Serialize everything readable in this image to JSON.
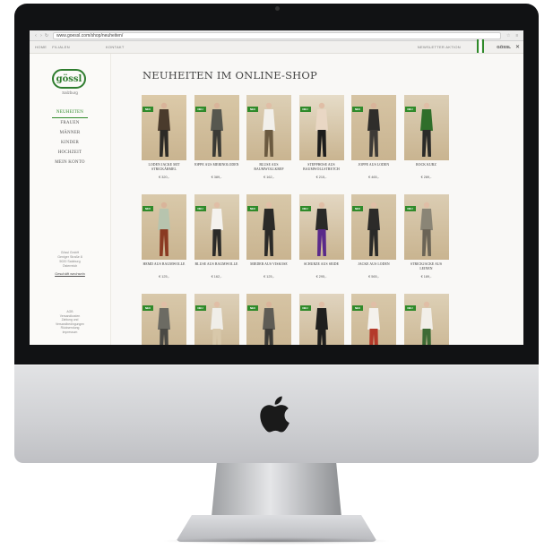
{
  "browser": {
    "url": "www.goessl.com/shop/neuheiten/",
    "nav_icons": [
      "back-arrow-icon",
      "forward-arrow-icon",
      "reload-icon"
    ]
  },
  "topbar": {
    "left_items": [
      "HOME",
      "FILIALEN",
      "KONTAKT"
    ],
    "right_text": "NEWSLETTER AKTION",
    "brand": "GÖSSL"
  },
  "sidebar": {
    "logo": "gössl",
    "logo_sub": "Salzburg",
    "nav": [
      {
        "label": "NEUHEITEN",
        "active": true
      },
      {
        "label": "FRAUEN",
        "active": false
      },
      {
        "label": "MÄNNER",
        "active": false
      },
      {
        "label": "KINDER",
        "active": false
      },
      {
        "label": "HOCHZEIT",
        "active": false
      },
      {
        "label": "MEIN KONTO",
        "active": false
      }
    ],
    "address": "Gössl GmbH\nGeniger Straße 8\n5020 Salzburg\nÖsterreich",
    "link": "Geschäft wechseln",
    "footer": "AGB\nVersandkosten\nZahlung und\nVersandbedingungen\nRücksendung\nImpressum"
  },
  "main": {
    "title": "NEUHEITEN IM ONLINE-SHOP",
    "badge": "NEU",
    "products": [
      {
        "name": "LODEN JACKE MIT STRICKÄRMEL",
        "price": "€ 320,-",
        "bg": "#dccaa9",
        "top": "#4a3b2c",
        "bottom": "#2c2a26",
        "skin": "#d9b49a"
      },
      {
        "name": "JOPPE AUS MERINOLODEN",
        "price": "€ 389,-",
        "bg": "#d8c7a6",
        "top": "#56574f",
        "bottom": "#3a3a35",
        "skin": "#d9b49a"
      },
      {
        "name": "BLUSE AUS BAUMWOLLKREP",
        "price": "€ 162,-",
        "bg": "#ddd0b6",
        "top": "#f2f0eb",
        "bottom": "#6b5a40",
        "skin": "#e0bea6"
      },
      {
        "name": "STEPPHOSE AUS BAUMWOLLSTRETCH",
        "price": "€ 215,-",
        "bg": "#e6dcc8",
        "top": "#e9d7c4",
        "bottom": "#1c1c1c",
        "skin": "#e0bea6"
      },
      {
        "name": "JOPPE AUS LODEN",
        "price": "€ 465,-",
        "bg": "#d6c4a4",
        "top": "#2f2e2b",
        "bottom": "#3d3a36",
        "skin": "#d9b49a"
      },
      {
        "name": "ROCK KURZ",
        "price": "€ 289,-",
        "bg": "#dccfb6",
        "top": "#2f6e2a",
        "bottom": "#2a2a28",
        "skin": "#e0bea6"
      },
      {
        "name": "HEMD AUS BAUMWOLLE",
        "price": "€ 125,-",
        "bg": "#d9c9aa",
        "top": "#b7c4ae",
        "bottom": "#8a3a22",
        "skin": "#d9b49a"
      },
      {
        "name": "BLUSE AUS BAUMWOLLE",
        "price": "€ 162,-",
        "bg": "#ddd0b6",
        "top": "#f4f2ee",
        "bottom": "#2a2a28",
        "skin": "#e0bea6"
      },
      {
        "name": "MIEDER AUS VISKOSE",
        "price": "€ 125,-",
        "bg": "#d8c8a9",
        "top": "#2a2a28",
        "bottom": "#2a2a28",
        "skin": "#e0bea6"
      },
      {
        "name": "SCHÜRZE AUS SEIDE",
        "price": "€ 295,-",
        "bg": "#e3d7c2",
        "top": "#2a2a28",
        "bottom": "#5a2a8a",
        "skin": "#e0bea6"
      },
      {
        "name": "JACKE AUS LODEN",
        "price": "€ 565,-",
        "bg": "#d6c6a8",
        "top": "#2c2b29",
        "bottom": "#2a2a28",
        "skin": "#e0bea6"
      },
      {
        "name": "STRICKJACKE AUS LEINEN",
        "price": "€ 189,-",
        "bg": "#dbcdb3",
        "top": "#8a8576",
        "bottom": "#6b6456",
        "skin": "#e0bea6"
      },
      {
        "name": "",
        "price": "",
        "bg": "#d8c8aa",
        "top": "#6c6b63",
        "bottom": "#4a4944",
        "skin": "#e0bea6"
      },
      {
        "name": "",
        "price": "",
        "bg": "#ddd0b8",
        "top": "#f0eee9",
        "bottom": "#d8c8aa",
        "skin": "#e0bea6"
      },
      {
        "name": "",
        "price": "",
        "bg": "#d6c4a4",
        "top": "#5e5c55",
        "bottom": "#3c3b37",
        "skin": "#d9b49a"
      },
      {
        "name": "",
        "price": "",
        "bg": "#e0d4bf",
        "top": "#1f1f1e",
        "bottom": "#1f1f1e",
        "skin": "#e0bea6"
      },
      {
        "name": "",
        "price": "",
        "bg": "#d8c8aa",
        "top": "#f4f1ec",
        "bottom": "#b43a2a",
        "skin": "#e0bea6"
      },
      {
        "name": "",
        "price": "",
        "bg": "#ddd0b6",
        "top": "#f2efe9",
        "bottom": "#3d6a34",
        "skin": "#e0bea6"
      }
    ]
  }
}
